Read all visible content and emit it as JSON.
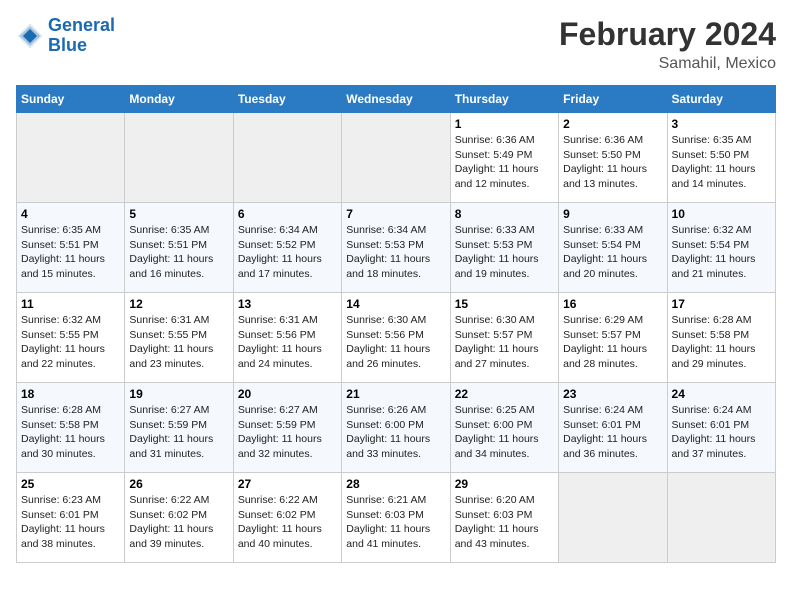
{
  "header": {
    "logo_line1": "General",
    "logo_line2": "Blue",
    "title": "February 2024",
    "subtitle": "Samahil, Mexico"
  },
  "days_of_week": [
    "Sunday",
    "Monday",
    "Tuesday",
    "Wednesday",
    "Thursday",
    "Friday",
    "Saturday"
  ],
  "weeks": [
    [
      {
        "day": "",
        "empty": true
      },
      {
        "day": "",
        "empty": true
      },
      {
        "day": "",
        "empty": true
      },
      {
        "day": "",
        "empty": true
      },
      {
        "day": "1",
        "sunrise": "Sunrise: 6:36 AM",
        "sunset": "Sunset: 5:49 PM",
        "daylight": "Daylight: 11 hours and 12 minutes."
      },
      {
        "day": "2",
        "sunrise": "Sunrise: 6:36 AM",
        "sunset": "Sunset: 5:50 PM",
        "daylight": "Daylight: 11 hours and 13 minutes."
      },
      {
        "day": "3",
        "sunrise": "Sunrise: 6:35 AM",
        "sunset": "Sunset: 5:50 PM",
        "daylight": "Daylight: 11 hours and 14 minutes."
      }
    ],
    [
      {
        "day": "4",
        "sunrise": "Sunrise: 6:35 AM",
        "sunset": "Sunset: 5:51 PM",
        "daylight": "Daylight: 11 hours and 15 minutes."
      },
      {
        "day": "5",
        "sunrise": "Sunrise: 6:35 AM",
        "sunset": "Sunset: 5:51 PM",
        "daylight": "Daylight: 11 hours and 16 minutes."
      },
      {
        "day": "6",
        "sunrise": "Sunrise: 6:34 AM",
        "sunset": "Sunset: 5:52 PM",
        "daylight": "Daylight: 11 hours and 17 minutes."
      },
      {
        "day": "7",
        "sunrise": "Sunrise: 6:34 AM",
        "sunset": "Sunset: 5:53 PM",
        "daylight": "Daylight: 11 hours and 18 minutes."
      },
      {
        "day": "8",
        "sunrise": "Sunrise: 6:33 AM",
        "sunset": "Sunset: 5:53 PM",
        "daylight": "Daylight: 11 hours and 19 minutes."
      },
      {
        "day": "9",
        "sunrise": "Sunrise: 6:33 AM",
        "sunset": "Sunset: 5:54 PM",
        "daylight": "Daylight: 11 hours and 20 minutes."
      },
      {
        "day": "10",
        "sunrise": "Sunrise: 6:32 AM",
        "sunset": "Sunset: 5:54 PM",
        "daylight": "Daylight: 11 hours and 21 minutes."
      }
    ],
    [
      {
        "day": "11",
        "sunrise": "Sunrise: 6:32 AM",
        "sunset": "Sunset: 5:55 PM",
        "daylight": "Daylight: 11 hours and 22 minutes."
      },
      {
        "day": "12",
        "sunrise": "Sunrise: 6:31 AM",
        "sunset": "Sunset: 5:55 PM",
        "daylight": "Daylight: 11 hours and 23 minutes."
      },
      {
        "day": "13",
        "sunrise": "Sunrise: 6:31 AM",
        "sunset": "Sunset: 5:56 PM",
        "daylight": "Daylight: 11 hours and 24 minutes."
      },
      {
        "day": "14",
        "sunrise": "Sunrise: 6:30 AM",
        "sunset": "Sunset: 5:56 PM",
        "daylight": "Daylight: 11 hours and 26 minutes."
      },
      {
        "day": "15",
        "sunrise": "Sunrise: 6:30 AM",
        "sunset": "Sunset: 5:57 PM",
        "daylight": "Daylight: 11 hours and 27 minutes."
      },
      {
        "day": "16",
        "sunrise": "Sunrise: 6:29 AM",
        "sunset": "Sunset: 5:57 PM",
        "daylight": "Daylight: 11 hours and 28 minutes."
      },
      {
        "day": "17",
        "sunrise": "Sunrise: 6:28 AM",
        "sunset": "Sunset: 5:58 PM",
        "daylight": "Daylight: 11 hours and 29 minutes."
      }
    ],
    [
      {
        "day": "18",
        "sunrise": "Sunrise: 6:28 AM",
        "sunset": "Sunset: 5:58 PM",
        "daylight": "Daylight: 11 hours and 30 minutes."
      },
      {
        "day": "19",
        "sunrise": "Sunrise: 6:27 AM",
        "sunset": "Sunset: 5:59 PM",
        "daylight": "Daylight: 11 hours and 31 minutes."
      },
      {
        "day": "20",
        "sunrise": "Sunrise: 6:27 AM",
        "sunset": "Sunset: 5:59 PM",
        "daylight": "Daylight: 11 hours and 32 minutes."
      },
      {
        "day": "21",
        "sunrise": "Sunrise: 6:26 AM",
        "sunset": "Sunset: 6:00 PM",
        "daylight": "Daylight: 11 hours and 33 minutes."
      },
      {
        "day": "22",
        "sunrise": "Sunrise: 6:25 AM",
        "sunset": "Sunset: 6:00 PM",
        "daylight": "Daylight: 11 hours and 34 minutes."
      },
      {
        "day": "23",
        "sunrise": "Sunrise: 6:24 AM",
        "sunset": "Sunset: 6:01 PM",
        "daylight": "Daylight: 11 hours and 36 minutes."
      },
      {
        "day": "24",
        "sunrise": "Sunrise: 6:24 AM",
        "sunset": "Sunset: 6:01 PM",
        "daylight": "Daylight: 11 hours and 37 minutes."
      }
    ],
    [
      {
        "day": "25",
        "sunrise": "Sunrise: 6:23 AM",
        "sunset": "Sunset: 6:01 PM",
        "daylight": "Daylight: 11 hours and 38 minutes."
      },
      {
        "day": "26",
        "sunrise": "Sunrise: 6:22 AM",
        "sunset": "Sunset: 6:02 PM",
        "daylight": "Daylight: 11 hours and 39 minutes."
      },
      {
        "day": "27",
        "sunrise": "Sunrise: 6:22 AM",
        "sunset": "Sunset: 6:02 PM",
        "daylight": "Daylight: 11 hours and 40 minutes."
      },
      {
        "day": "28",
        "sunrise": "Sunrise: 6:21 AM",
        "sunset": "Sunset: 6:03 PM",
        "daylight": "Daylight: 11 hours and 41 minutes."
      },
      {
        "day": "29",
        "sunrise": "Sunrise: 6:20 AM",
        "sunset": "Sunset: 6:03 PM",
        "daylight": "Daylight: 11 hours and 43 minutes."
      },
      {
        "day": "",
        "empty": true
      },
      {
        "day": "",
        "empty": true
      }
    ]
  ]
}
